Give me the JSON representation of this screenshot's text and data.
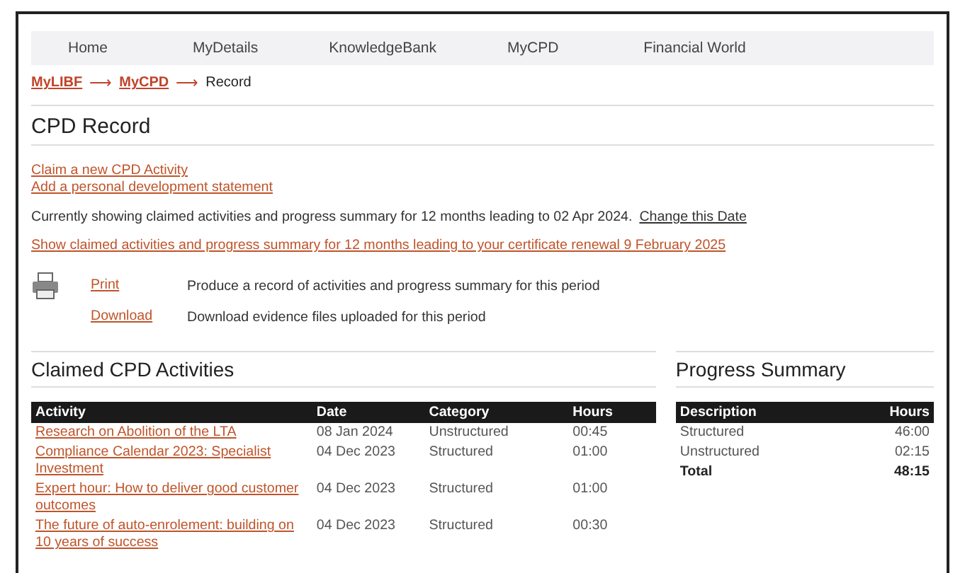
{
  "nav": {
    "items": [
      {
        "label": "Home"
      },
      {
        "label": "MyDetails"
      },
      {
        "label": "KnowledgeBank"
      },
      {
        "label": "MyCPD"
      },
      {
        "label": "Financial World"
      }
    ]
  },
  "breadcrumb": [
    {
      "label": "MyLIBF",
      "kind": "link"
    },
    {
      "label": "MyCPD",
      "kind": "link"
    },
    {
      "label": "Record",
      "kind": "current"
    }
  ],
  "breadcrumb_separator": "⟶",
  "title": "CPD Record",
  "actions": [
    "Claim a new CPD Activity",
    "Add a personal development statement"
  ],
  "period": {
    "text": "Currently showing claimed activities and progress summary for 12 months leading to 02 Apr 2024.",
    "change_link": "Change this Date",
    "renewal_link": "Show claimed activities and progress summary for 12 months leading to your certificate renewal 9 February 2025"
  },
  "exports": [
    {
      "link": "Print",
      "description": "Produce a record of activities and progress summary for this period"
    },
    {
      "link": "Download",
      "description": "Download evidence files uploaded for this period"
    }
  ],
  "activities": {
    "title": "Claimed CPD Activities",
    "columns": [
      "Activity",
      "Date",
      "Category",
      "Hours"
    ],
    "rows": [
      {
        "activity": "Research on Abolition of the LTA",
        "date": "08 Jan 2024",
        "category": "Unstructured",
        "hours": "00:45"
      },
      {
        "activity": "Compliance Calendar 2023: Specialist Investment",
        "date": "04 Dec 2023",
        "category": "Structured",
        "hours": "01:00"
      },
      {
        "activity": "Expert hour: How to deliver good customer outcomes",
        "date": "04 Dec 2023",
        "category": "Structured",
        "hours": "01:00"
      },
      {
        "activity": "The future of auto-enrolement: building on 10 years of success",
        "date": "04 Dec 2023",
        "category": "Structured",
        "hours": "00:30"
      }
    ]
  },
  "summary": {
    "title": "Progress Summary",
    "columns": [
      "Description",
      "Hours"
    ],
    "rows": [
      {
        "description": "Structured",
        "hours": "46:00",
        "kind": "item"
      },
      {
        "description": "Unstructured",
        "hours": "02:15",
        "kind": "item"
      },
      {
        "description": "Total",
        "hours": "48:15",
        "kind": "total"
      }
    ]
  }
}
